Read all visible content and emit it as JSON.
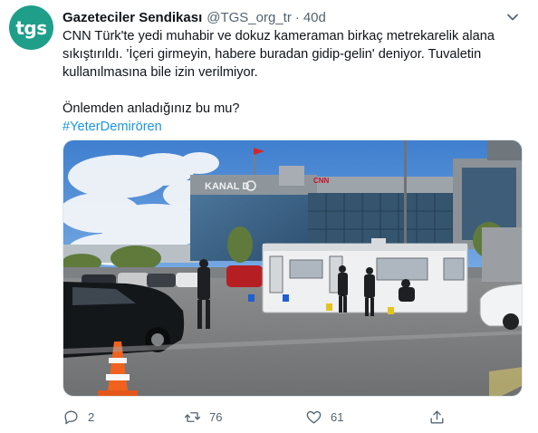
{
  "author": {
    "avatar_text": "tgs",
    "display_name": "Gazeteciler Sendikası",
    "handle": "@TGS_org_tr",
    "separator": "·",
    "time": "40d"
  },
  "tweet": {
    "line1": "CNN Türk'te yedi muhabir ve dokuz kameraman birkaç metrekarelik alana",
    "line2": "sıkıştırıldı. 'İçeri girmeyin, habere buradan gidip-gelin' deniyor. Tuvaletin",
    "line3": "kullanılmasına bile izin verilmiyor.",
    "line4": "Önlemden anladığınız bu mu?",
    "hashtag": "#YeterDemirören"
  },
  "photo": {
    "building_sign": "KANAL D",
    "building_logo": "CNN"
  },
  "actions": {
    "reply_count": "2",
    "retweet_count": "76",
    "like_count": "61"
  },
  "colors": {
    "avatar_bg": "#1f9e8a",
    "link": "#1b95e0",
    "secondary_text": "#536471"
  }
}
